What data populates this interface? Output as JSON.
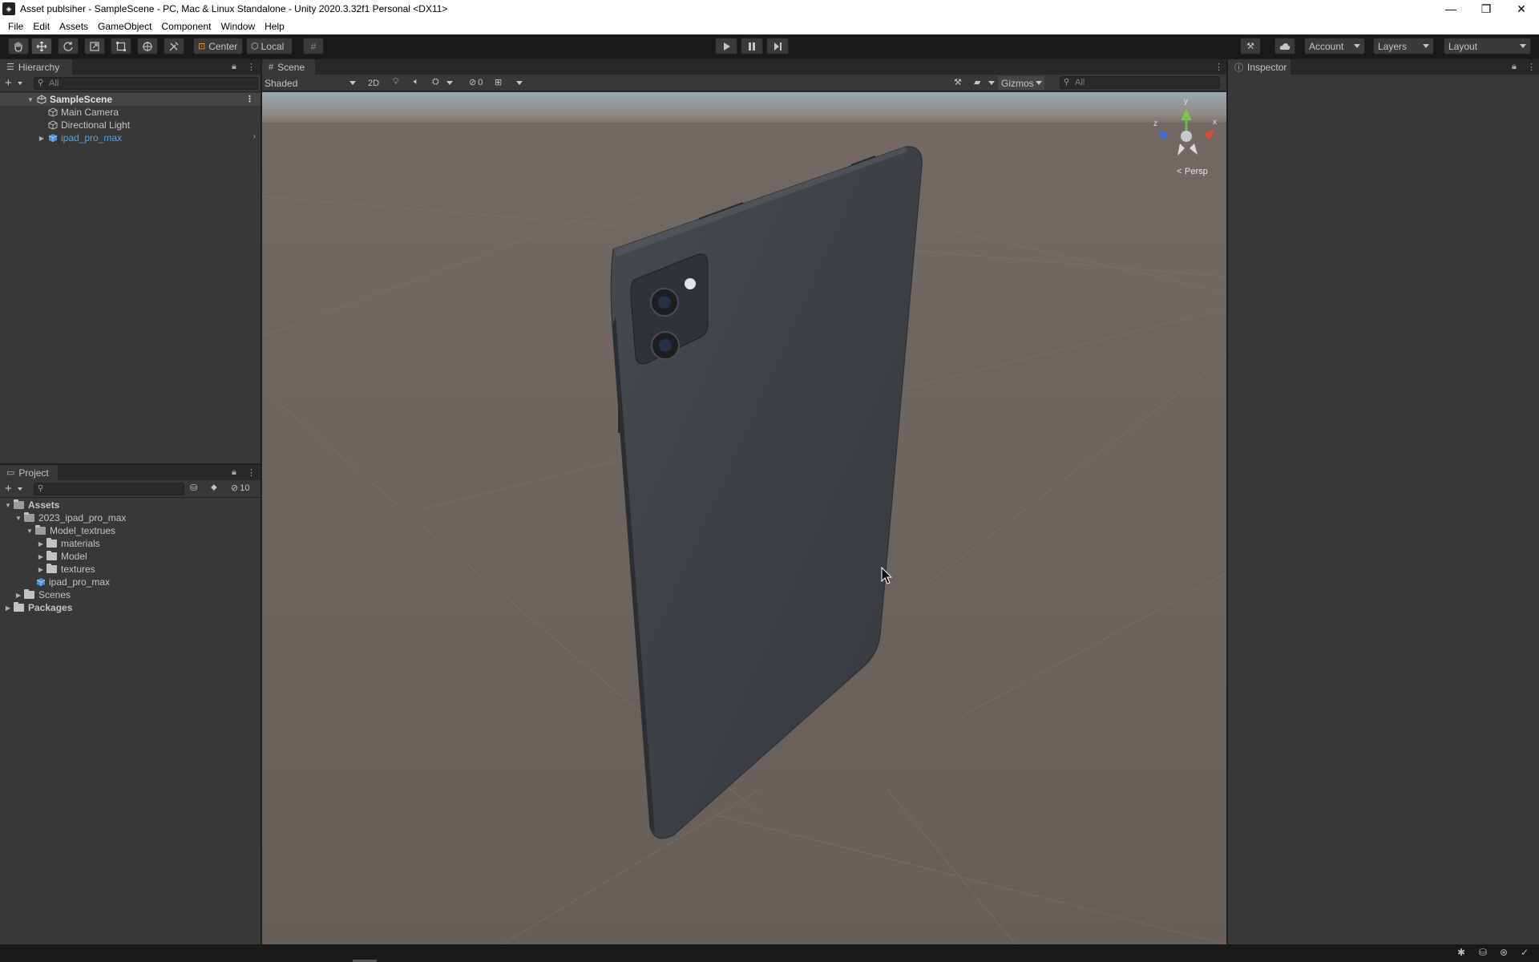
{
  "window": {
    "title": "Asset publsiher - SampleScene - PC, Mac & Linux Standalone - Unity 2020.3.32f1 Personal <DX11>",
    "app_icon": "unity-icon"
  },
  "menubar": {
    "items": [
      "File",
      "Edit",
      "Assets",
      "GameObject",
      "Component",
      "Window",
      "Help"
    ]
  },
  "toolbar": {
    "tools": [
      "hand-tool-icon",
      "move-tool-icon",
      "rotate-tool-icon",
      "scale-tool-icon",
      "rect-tool-icon",
      "transform-tool-icon",
      "custom-tool-icon"
    ],
    "pivot_label": "Center",
    "space_label": "Local",
    "account_label": "Account",
    "layers_label": "Layers",
    "layout_label": "Layout"
  },
  "hierarchy": {
    "tab_label": "Hierarchy",
    "search_placeholder": "All",
    "scene_name": "SampleScene",
    "items": [
      "Main Camera",
      "Directional Light",
      "ipad_pro_max"
    ]
  },
  "project": {
    "tab_label": "Project",
    "hidden_count": "10",
    "tree": {
      "assets": "Assets",
      "folder_2023": "2023_ipad_pro_max",
      "model_textrues": "Model_textrues",
      "materials": "materials",
      "model": "Model",
      "textures": "textures",
      "prefab": "ipad_pro_max",
      "scenes": "Scenes",
      "packages": "Packages"
    }
  },
  "scene": {
    "tab_label": "Scene",
    "shading_mode": "Shaded",
    "mode_2d": "2D",
    "hidden_objects_count": "0",
    "gizmos_label": "Gizmos",
    "search_placeholder": "All",
    "projection_label": "Persp",
    "gizmo_axes": {
      "y": "y",
      "x": "x",
      "z": "z"
    }
  },
  "inspector": {
    "tab_label": "Inspector"
  },
  "colors": {
    "accent_blue": "#5a9ee6",
    "panel_bg": "#383838",
    "toolbar_bg": "#191919",
    "ground": "#6b625d",
    "device_body": "#3d4145"
  }
}
